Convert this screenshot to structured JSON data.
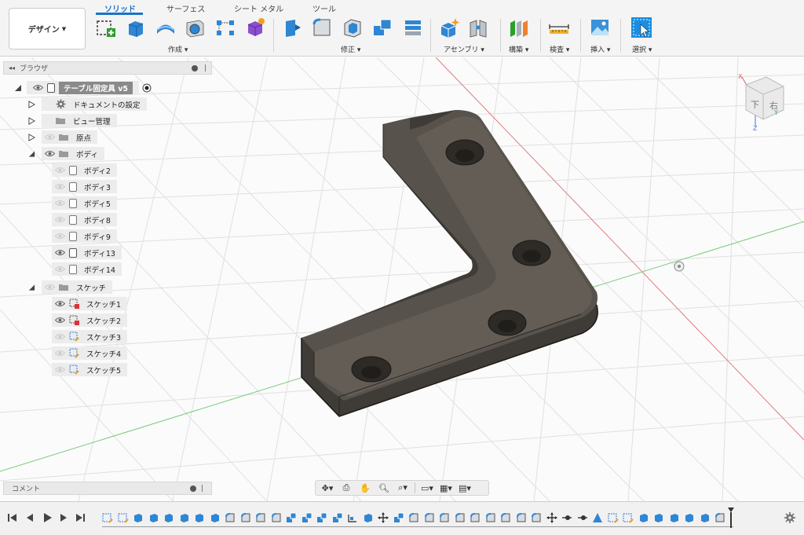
{
  "toolbar": {
    "design_label": "デザイン",
    "tabs": [
      "ソリッド",
      "サーフェス",
      "シート メタル",
      "ツール"
    ],
    "groups": {
      "create": "作成",
      "modify": "修正",
      "assemble": "アセンブリ",
      "construct": "構築",
      "inspect": "検査",
      "insert": "挿入",
      "select": "選択"
    }
  },
  "browser": {
    "title": "ブラウザ",
    "root": "テーブル固定具 v5",
    "items": [
      {
        "label": "ドキュメントの設定",
        "icon": "gear-icon"
      },
      {
        "label": "ビュー管理",
        "icon": "folder-icon"
      },
      {
        "label": "原点",
        "icon": "folder-icon"
      },
      {
        "label": "ボディ",
        "icon": "folder-icon"
      }
    ],
    "bodies": [
      "ボディ2",
      "ボディ3",
      "ボディ5",
      "ボディ8",
      "ボディ9",
      "ボディ13",
      "ボディ14"
    ],
    "sketch_folder": "スケッチ",
    "sketches": [
      "スケッチ1",
      "スケッチ2",
      "スケッチ3",
      "スケッチ4",
      "スケッチ5"
    ]
  },
  "comments": {
    "title": "コメント"
  },
  "viewcube": {
    "face_front": "下",
    "face_right": "右",
    "axis_x": "X",
    "axis_y": "Y",
    "axis_z": "Z"
  },
  "colors": {
    "accent": "#1a73c7",
    "part_fill": "#4a4640",
    "grid_red": "#e06060",
    "grid_green": "#6cc46c"
  }
}
